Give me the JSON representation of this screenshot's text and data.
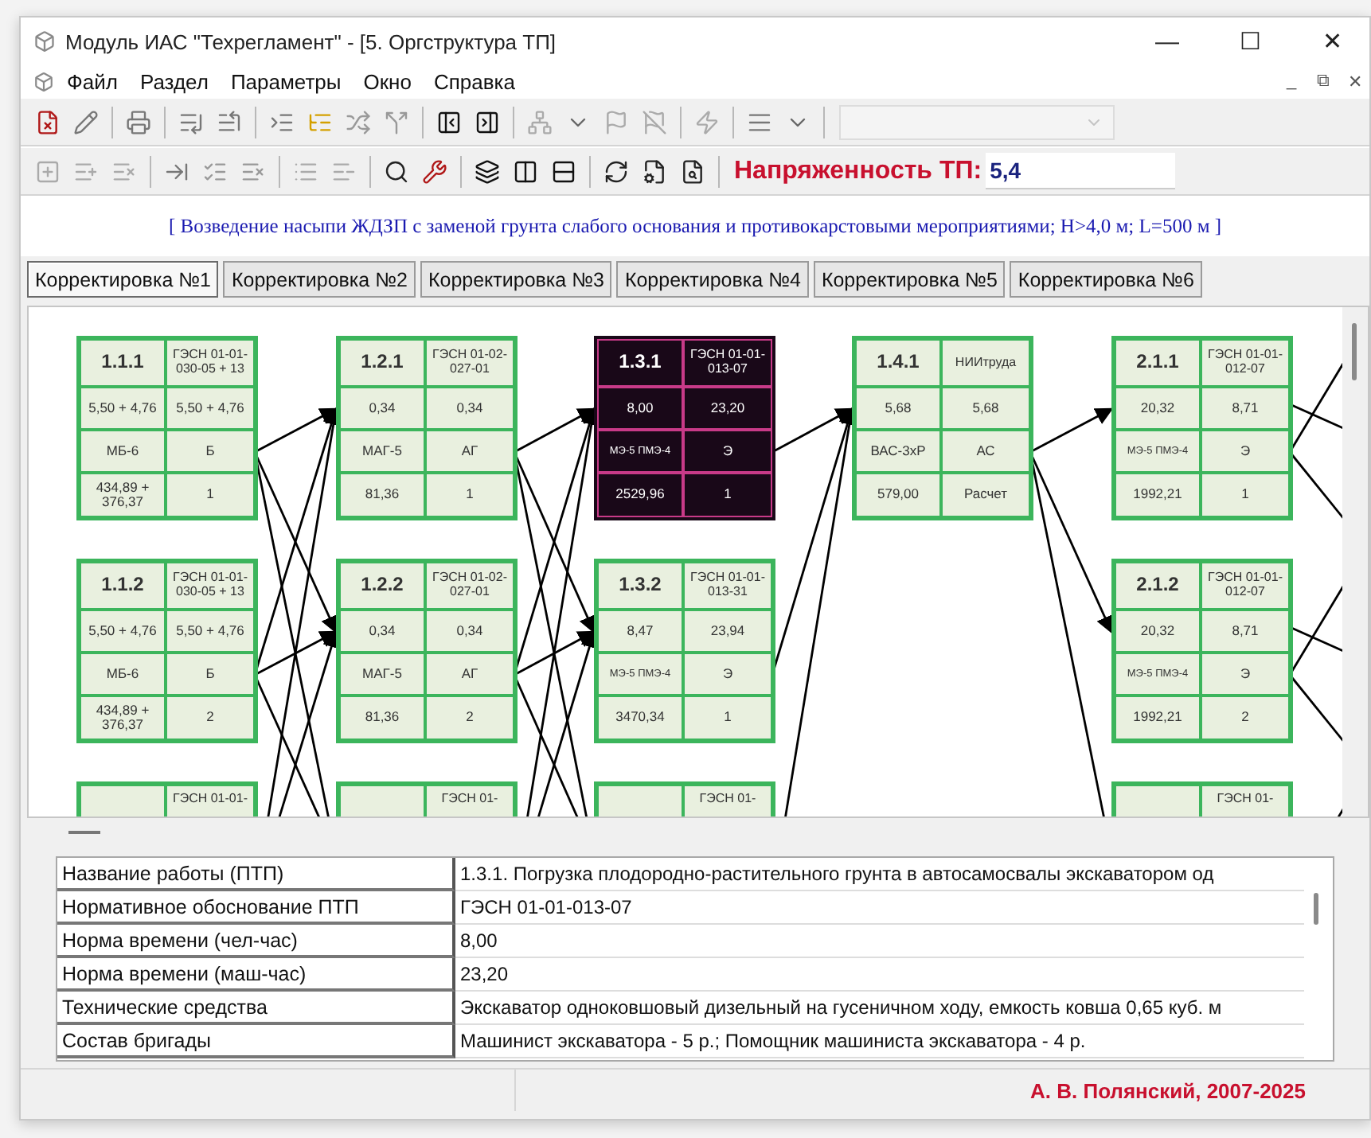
{
  "window": {
    "title": "Модуль ИАС \"Техрегламент\" - [5. Оргструктура ТП]",
    "controls": [
      "—",
      "☐",
      "✕"
    ]
  },
  "menu": {
    "items": [
      "Файл",
      "Раздел",
      "Параметры",
      "Окно",
      "Справка"
    ],
    "mdi_controls": [
      "_",
      "⧉",
      "✕"
    ]
  },
  "toolbar": {
    "combo_disabled": true,
    "tension_label": "Напряженность ТП:",
    "tension_value": "5,4"
  },
  "subtitle": "[ Возведение насыпи ЖДЗП с заменой грунта слабого основания и противокарстовыми мероприятиями; H>4,0 м; L=500 м ]",
  "tabs": [
    {
      "label": "Корректировка №1",
      "selected": true
    },
    {
      "label": "Корректировка №2",
      "selected": false
    },
    {
      "label": "Корректировка №3",
      "selected": false
    },
    {
      "label": "Корректировка №4",
      "selected": false
    },
    {
      "label": "Корректировка №5",
      "selected": false
    },
    {
      "label": "Корректировка №6",
      "selected": false
    }
  ],
  "diagram": {
    "columns": [
      {
        "nodes": [
          {
            "kind": "node",
            "id": "1.1.1",
            "code": "ГЭСН 01-01-030-05 + 13",
            "cells": [
              "5,50 + 4,76",
              "5,50 + 4,76",
              "МБ-6",
              "Б",
              "434,89 + 376,37",
              "1"
            ],
            "selected": false
          },
          {
            "kind": "node",
            "id": "1.1.2",
            "code": "ГЭСН 01-01-030-05 + 13",
            "cells": [
              "5,50 + 4,76",
              "5,50 + 4,76",
              "МБ-6",
              "Б",
              "434,89 + 376,37",
              "2"
            ],
            "selected": false
          },
          {
            "kind": "cut",
            "code": "ГЭСН 01-01-"
          }
        ]
      },
      {
        "nodes": [
          {
            "kind": "node",
            "id": "1.2.1",
            "code": "ГЭСН 01-02-027-01",
            "cells": [
              "0,34",
              "0,34",
              "МАГ-5",
              "АГ",
              "81,36",
              "1"
            ],
            "selected": false
          },
          {
            "kind": "node",
            "id": "1.2.2",
            "code": "ГЭСН 01-02-027-01",
            "cells": [
              "0,34",
              "0,34",
              "МАГ-5",
              "АГ",
              "81,36",
              "2"
            ],
            "selected": false
          },
          {
            "kind": "cut",
            "code": "ГЭСН 01-"
          }
        ]
      },
      {
        "nodes": [
          {
            "kind": "node",
            "id": "1.3.1",
            "code": "ГЭСН 01-01-013-07",
            "cells": [
              "8,00",
              "23,20",
              "МЭ-5 ПМЭ-4",
              "Э",
              "2529,96",
              "1"
            ],
            "selected": true
          },
          {
            "kind": "node",
            "id": "1.3.2",
            "code": "ГЭСН 01-01-013-31",
            "cells": [
              "8,47",
              "23,94",
              "МЭ-5 ПМЭ-4",
              "Э",
              "3470,34",
              "1"
            ],
            "selected": false
          },
          {
            "kind": "cut",
            "code": "ГЭСН 01-"
          }
        ]
      },
      {
        "nodes": [
          {
            "kind": "node",
            "id": "1.4.1",
            "code": "НИИтруда",
            "cells": [
              "5,68",
              "5,68",
              "ВАС-3хР",
              "АС",
              "579,00",
              "Расчет"
            ],
            "selected": false
          }
        ]
      },
      {
        "nodes": [
          {
            "kind": "node",
            "id": "2.1.1",
            "code": "ГЭСН 01-01-012-07",
            "cells": [
              "20,32",
              "8,71",
              "МЭ-5 ПМЭ-4",
              "Э",
              "1992,21",
              "1"
            ],
            "selected": false
          },
          {
            "kind": "node",
            "id": "2.1.2",
            "code": "ГЭСН 01-01-012-07",
            "cells": [
              "20,32",
              "8,71",
              "МЭ-5 ПМЭ-4",
              "Э",
              "1992,21",
              "2"
            ],
            "selected": false
          },
          {
            "kind": "cut",
            "code": "ГЭСН 01-"
          }
        ]
      }
    ]
  },
  "properties": [
    {
      "label": "Название работы (ПТП)",
      "value": "1.3.1. Погрузка плодородно-растительного грунта в автосамосвалы экскаватором од"
    },
    {
      "label": "Нормативное обоснование ПТП",
      "value": "ГЭСН 01-01-013-07"
    },
    {
      "label": "Норма времени (чел-час)",
      "value": "8,00"
    },
    {
      "label": "Норма времени (маш-час)",
      "value": "23,20"
    },
    {
      "label": "Технические средства",
      "value": "Экскаватор одноковшовый дизельный на гусеничном ходу, емкость ковша 0,65 куб. м"
    },
    {
      "label": "Состав бригады",
      "value": "Машинист экскаватора - 5 р.; Помощник машиниста экскаватора - 4 р."
    }
  ],
  "status_bar": {
    "author": "А. В. Полянский, 2007-2025"
  }
}
